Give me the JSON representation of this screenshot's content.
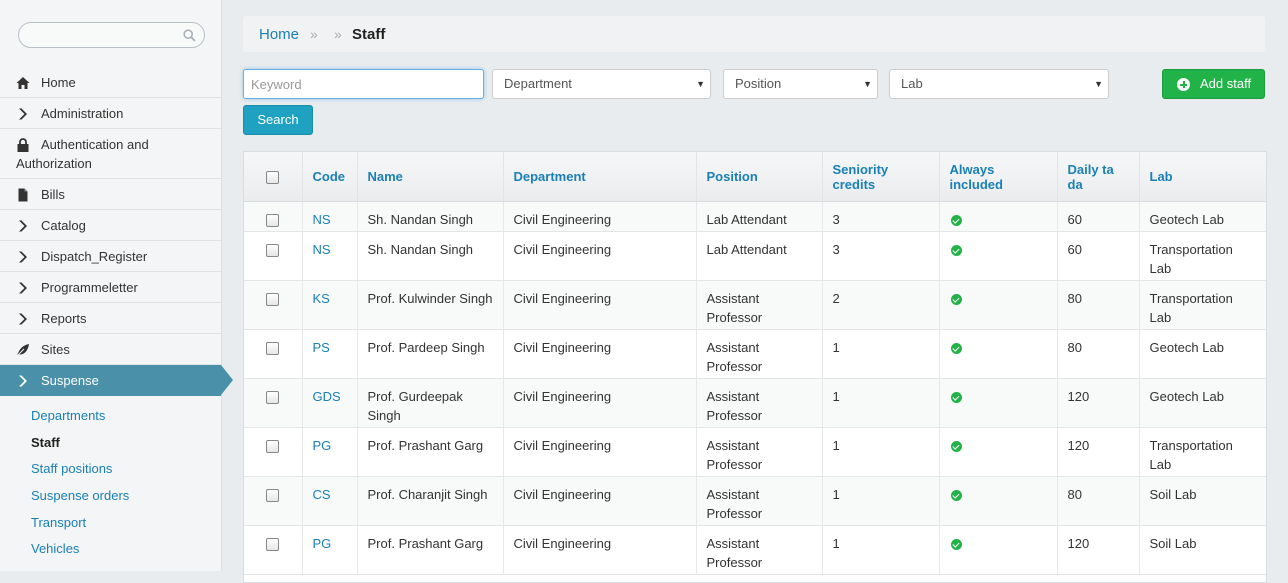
{
  "search": {
    "placeholder": ""
  },
  "nav": {
    "items": [
      {
        "label": "Home",
        "icon": "home-icon"
      },
      {
        "label": "Administration",
        "icon": "chevron-right-icon"
      },
      {
        "label": "Authentication and Authorization",
        "icon": "lock-icon"
      },
      {
        "label": "Bills",
        "icon": "file-icon"
      },
      {
        "label": "Catalog",
        "icon": "chevron-right-icon"
      },
      {
        "label": "Dispatch_Register",
        "icon": "chevron-right-icon"
      },
      {
        "label": "Programmeletter",
        "icon": "chevron-right-icon"
      },
      {
        "label": "Reports",
        "icon": "chevron-right-icon"
      },
      {
        "label": "Sites",
        "icon": "leaf-icon"
      },
      {
        "label": "Suspense",
        "icon": "chevron-right-icon"
      }
    ],
    "active_index": 9,
    "active_color": "#4a90a9",
    "sub_items": [
      "Departments",
      "Staff",
      "Staff positions",
      "Suspense orders",
      "Transport",
      "Vehicles"
    ],
    "current_sub": "Staff"
  },
  "breadcrumb": {
    "home": "Home",
    "separator": "»",
    "current": "Staff"
  },
  "filters": {
    "keyword_placeholder": "Keyword",
    "department": "Department",
    "position": "Position",
    "lab": "Lab",
    "search_label": "Search",
    "add_label": "Add staff",
    "add_color": "#22b348",
    "search_color": "#1fa2c2"
  },
  "table": {
    "headers": {
      "code": "Code",
      "name": "Name",
      "department": "Department",
      "position": "Position",
      "seniority": "Seniority credits",
      "always": "Always included",
      "daily": "Daily ta da",
      "lab": "Lab"
    },
    "rows": [
      {
        "code": "NS",
        "name": "Sh. Nandan Singh",
        "department": "Civil Engineering",
        "position": "Lab Attendant",
        "seniority": "3",
        "always_included": true,
        "daily": "60",
        "lab": "Geotech Lab"
      },
      {
        "code": "NS",
        "name": "Sh. Nandan Singh",
        "department": "Civil Engineering",
        "position": "Lab Attendant",
        "seniority": "3",
        "always_included": true,
        "daily": "60",
        "lab": "Transportation Lab"
      },
      {
        "code": "KS",
        "name": "Prof. Kulwinder Singh",
        "department": "Civil Engineering",
        "position": "Assistant Professor",
        "seniority": "2",
        "always_included": true,
        "daily": "80",
        "lab": "Transportation Lab"
      },
      {
        "code": "PS",
        "name": "Prof. Pardeep Singh",
        "department": "Civil Engineering",
        "position": "Assistant Professor",
        "seniority": "1",
        "always_included": true,
        "daily": "80",
        "lab": "Geotech Lab"
      },
      {
        "code": "GDS",
        "name": "Prof. Gurdeepak Singh",
        "department": "Civil Engineering",
        "position": "Assistant Professor",
        "seniority": "1",
        "always_included": true,
        "daily": "120",
        "lab": "Geotech Lab"
      },
      {
        "code": "PG",
        "name": "Prof. Prashant Garg",
        "department": "Civil Engineering",
        "position": "Assistant Professor",
        "seniority": "1",
        "always_included": true,
        "daily": "120",
        "lab": "Transportation Lab"
      },
      {
        "code": "CS",
        "name": "Prof. Charanjit Singh",
        "department": "Civil Engineering",
        "position": "Assistant Professor",
        "seniority": "1",
        "always_included": true,
        "daily": "80",
        "lab": "Soil Lab"
      },
      {
        "code": "PG",
        "name": "Prof. Prashant Garg",
        "department": "Civil Engineering",
        "position": "Assistant Professor",
        "seniority": "1",
        "always_included": true,
        "daily": "120",
        "lab": "Soil Lab"
      }
    ]
  }
}
